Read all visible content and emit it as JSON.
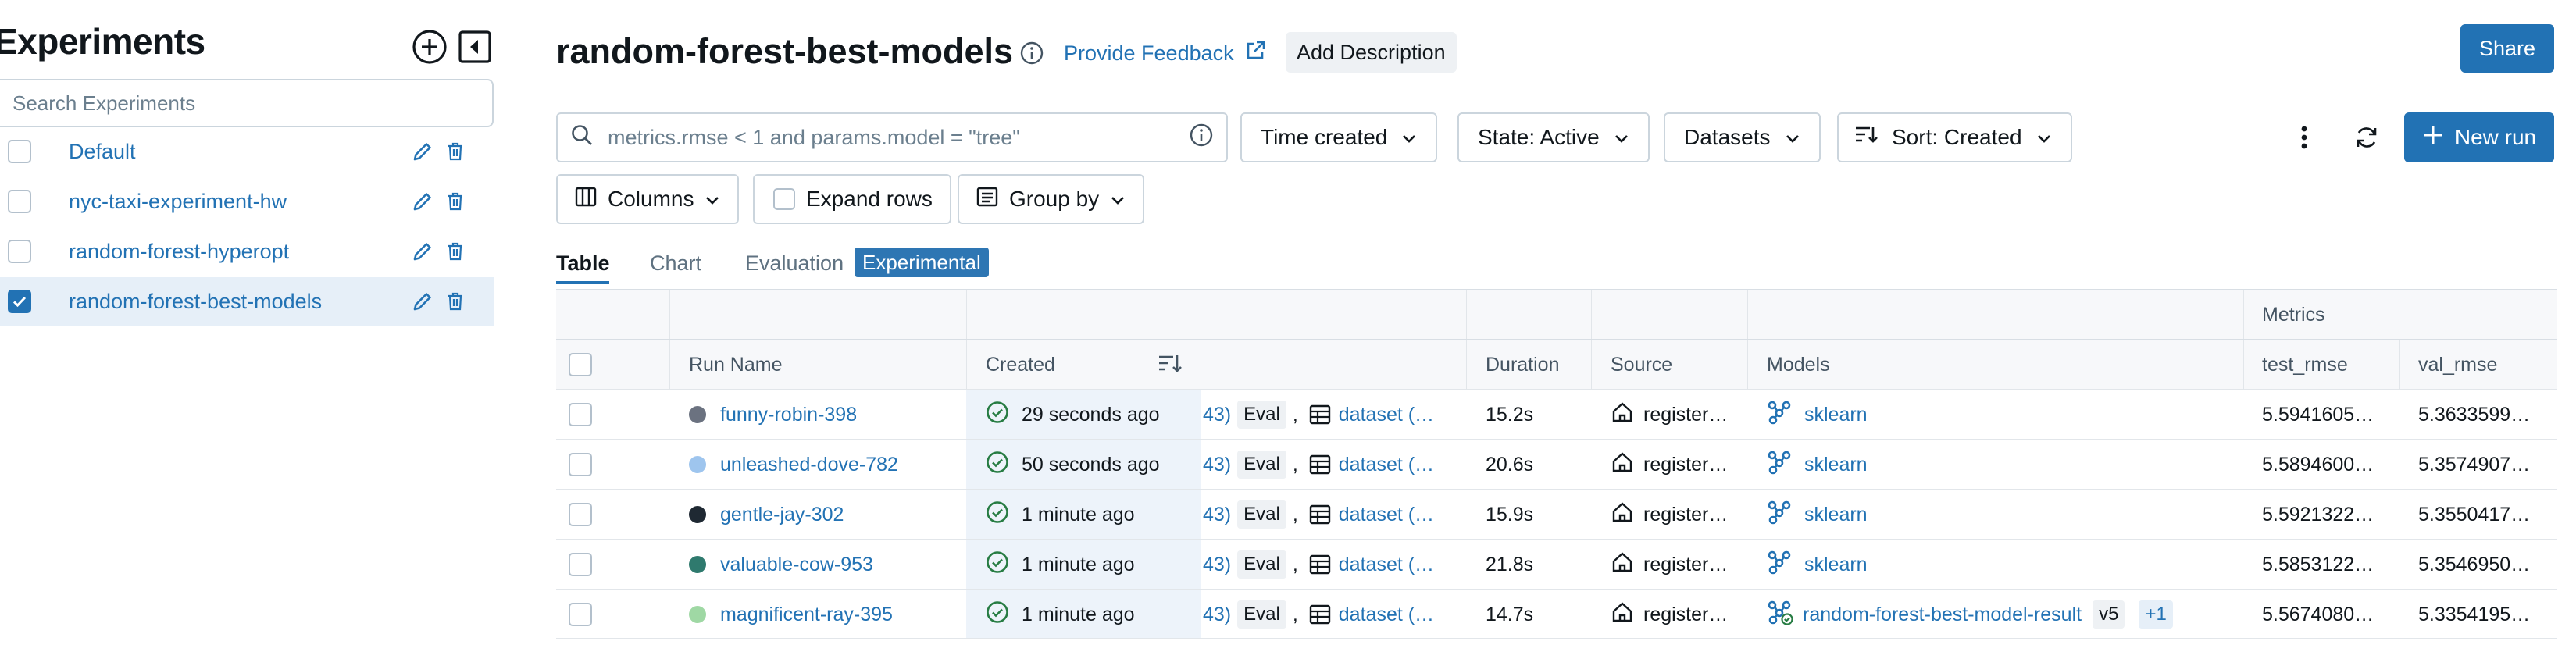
{
  "sidebar": {
    "title": "Experiments",
    "search_placeholder": "Search Experiments",
    "items": [
      {
        "name": "Default",
        "checked": false
      },
      {
        "name": "nyc-taxi-experiment-hw",
        "checked": false
      },
      {
        "name": "random-forest-hyperopt",
        "checked": false
      },
      {
        "name": "random-forest-best-models",
        "checked": true
      }
    ]
  },
  "header": {
    "title": "random-forest-best-models",
    "feedback_label": "Provide Feedback",
    "add_description_label": "Add Description",
    "share_label": "Share"
  },
  "toolbar": {
    "filter_placeholder": "metrics.rmse < 1 and params.model = \"tree\"",
    "time_created_label": "Time created",
    "state_label": "State: Active",
    "datasets_label": "Datasets",
    "sort_label": "Sort: Created",
    "new_run_label": "New run",
    "columns_label": "Columns",
    "expand_rows_label": "Expand rows",
    "group_by_label": "Group by"
  },
  "tabs": {
    "table": "Table",
    "chart": "Chart",
    "evaluation": "Evaluation",
    "experimental_badge": "Experimental"
  },
  "table": {
    "group_header_metrics": "Metrics",
    "headers": {
      "run_name": "Run Name",
      "created": "Created",
      "duration": "Duration",
      "source": "Source",
      "models": "Models",
      "test_rmse": "test_rmse",
      "val_rmse": "val_rmse"
    },
    "rows": [
      {
        "run_name": "funny-robin-398",
        "color": "#6b7280",
        "created": "29 seconds ago",
        "dataset_prefix": "43)",
        "eval_tag": "Eval",
        "comma": ",",
        "dataset": "dataset (…",
        "duration": "15.2s",
        "source": "register…",
        "model": "sklearn",
        "model_version": "",
        "model_extra": "",
        "test_rmse": "5.5941605…",
        "val_rmse": "5.3633599…"
      },
      {
        "run_name": "unleashed-dove-782",
        "color": "#9ec5ee",
        "created": "50 seconds ago",
        "dataset_prefix": "43)",
        "eval_tag": "Eval",
        "comma": ",",
        "dataset": "dataset (…",
        "duration": "20.6s",
        "source": "register…",
        "model": "sklearn",
        "model_version": "",
        "model_extra": "",
        "test_rmse": "5.5894600…",
        "val_rmse": "5.3574907…"
      },
      {
        "run_name": "gentle-jay-302",
        "color": "#1f2933",
        "created": "1 minute ago",
        "dataset_prefix": "43)",
        "eval_tag": "Eval",
        "comma": ",",
        "dataset": "dataset (…",
        "duration": "15.9s",
        "source": "register…",
        "model": "sklearn",
        "model_version": "",
        "model_extra": "",
        "test_rmse": "5.5921322…",
        "val_rmse": "5.3550417…"
      },
      {
        "run_name": "valuable-cow-953",
        "color": "#2f7a6e",
        "created": "1 minute ago",
        "dataset_prefix": "43)",
        "eval_tag": "Eval",
        "comma": ",",
        "dataset": "dataset (…",
        "duration": "21.8s",
        "source": "register…",
        "model": "sklearn",
        "model_version": "",
        "model_extra": "",
        "test_rmse": "5.5853122…",
        "val_rmse": "5.3546950…"
      },
      {
        "run_name": "magnificent-ray-395",
        "color": "#9fd8a4",
        "created": "1 minute ago",
        "dataset_prefix": "43)",
        "eval_tag": "Eval",
        "comma": ",",
        "dataset": "dataset (…",
        "duration": "14.7s",
        "source": "register…",
        "model": "random-forest-best-model-result",
        "model_version": "v5",
        "model_extra": "+1",
        "test_rmse": "5.5674080…",
        "val_rmse": "5.3354195…"
      }
    ]
  },
  "colors": {
    "accent": "#2272b4",
    "selected_row": "#e6eff8",
    "success": "#277c43"
  }
}
